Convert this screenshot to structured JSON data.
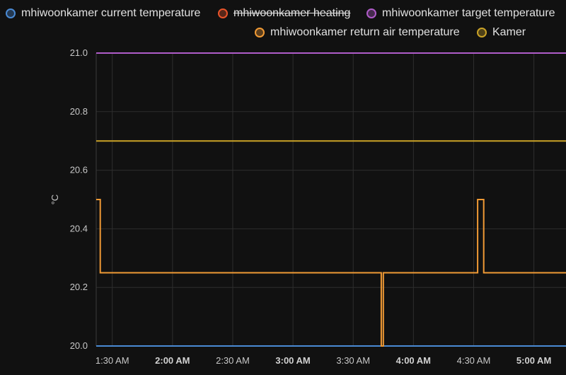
{
  "chart_data": {
    "type": "line",
    "ylabel": "°C",
    "ylim": [
      20.0,
      21.0
    ],
    "yticks": [
      "20.0",
      "20.2",
      "20.4",
      "20.6",
      "20.8",
      "21.0"
    ],
    "xlim": [
      "01:22",
      "05:16"
    ],
    "xticks": [
      {
        "label": "1:30 AM",
        "t": "01:30",
        "major": false
      },
      {
        "label": "2:00 AM",
        "t": "02:00",
        "major": true
      },
      {
        "label": "2:30 AM",
        "t": "02:30",
        "major": false
      },
      {
        "label": "3:00 AM",
        "t": "03:00",
        "major": true
      },
      {
        "label": "3:30 AM",
        "t": "03:30",
        "major": false
      },
      {
        "label": "4:00 AM",
        "t": "04:00",
        "major": true
      },
      {
        "label": "4:30 AM",
        "t": "04:30",
        "major": false
      },
      {
        "label": "5:00 AM",
        "t": "05:00",
        "major": true
      }
    ],
    "grid": true,
    "series": [
      {
        "name": "mhiwoonkamer current temperature",
        "color": "#4a8ad4",
        "visible": true,
        "points": [
          [
            "01:22",
            20.0
          ],
          [
            "05:16",
            20.0
          ]
        ]
      },
      {
        "name": "mhiwoonkamer heating",
        "color": "#e8532a",
        "visible": false,
        "points": []
      },
      {
        "name": "mhiwoonkamer target temperature",
        "color": "#b05cc9",
        "visible": true,
        "points": [
          [
            "01:22",
            21.0
          ],
          [
            "05:16",
            21.0
          ]
        ]
      },
      {
        "name": "mhiwoonkamer return air temperature",
        "color": "#f09a35",
        "visible": true,
        "points": [
          [
            "01:22",
            20.5
          ],
          [
            "01:24",
            20.5
          ],
          [
            "01:24",
            20.25
          ],
          [
            "03:44",
            20.25
          ],
          [
            "03:44",
            20.0
          ],
          [
            "03:45",
            20.0
          ],
          [
            "03:45",
            20.25
          ],
          [
            "04:32",
            20.25
          ],
          [
            "04:32",
            20.5
          ],
          [
            "04:35",
            20.5
          ],
          [
            "04:35",
            20.25
          ],
          [
            "04:35",
            20.5
          ],
          [
            "04:35",
            20.5
          ],
          [
            "04:35",
            20.25
          ],
          [
            "05:16",
            20.25
          ]
        ]
      },
      {
        "name": "Kamer",
        "color": "#c9a227",
        "visible": true,
        "points": [
          [
            "01:22",
            20.7
          ],
          [
            "05:16",
            20.7
          ]
        ]
      }
    ]
  }
}
